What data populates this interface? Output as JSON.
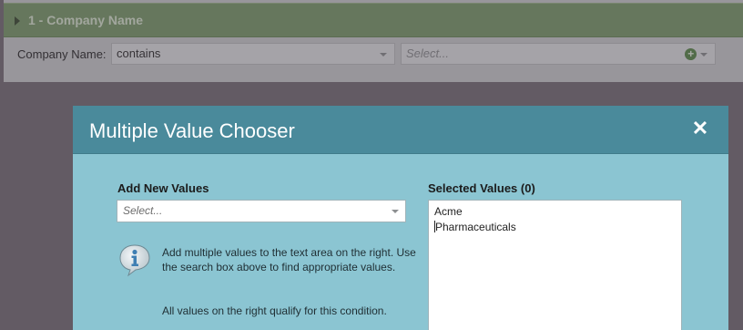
{
  "filter": {
    "title": "1 - Company Name",
    "field_label": "Company Name:",
    "operator_value": "contains",
    "value_placeholder": "Select..."
  },
  "modal": {
    "title": "Multiple Value Chooser",
    "close_glyph": "✕",
    "add_section_label": "Add New Values",
    "add_select_placeholder": "Select...",
    "help_text": "Add multiple values to the text area on the right. Use the search box above to find appropriate values.",
    "help_text_2": "All values on the right qualify for this condition.",
    "selected_section_label": "Selected Values (0)",
    "selected_values": [
      "Acme",
      "Pharmaceuticals"
    ]
  },
  "icons": {
    "expand": "triangle-right-icon",
    "add": "plus-circle-icon",
    "info": "info-icon"
  },
  "colors": {
    "header_green": "#7d9b6d",
    "modal_header": "#4a8a9b",
    "modal_body": "#8bc5d2"
  }
}
